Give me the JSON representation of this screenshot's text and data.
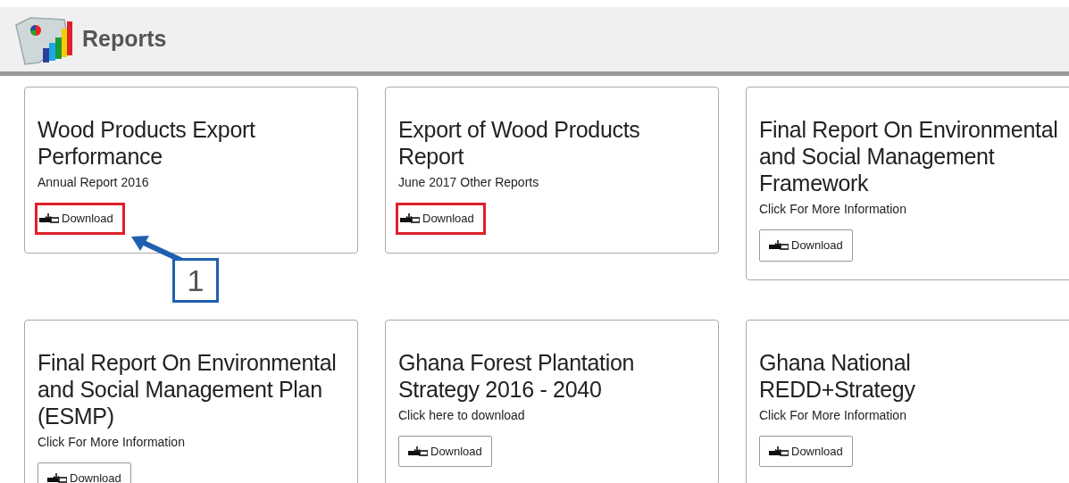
{
  "header": {
    "title": "Reports"
  },
  "reports": [
    {
      "title": "Wood Products Export Performance",
      "subtitle": "Annual Report 2016",
      "button": "Download",
      "highlighted": true
    },
    {
      "title": "Export of Wood Products Report",
      "subtitle": "June 2017 Other Reports",
      "button": "Download",
      "highlighted": true
    },
    {
      "title": "Final Report On Environmental and Social Management Framework",
      "subtitle": "Click For More Information",
      "button": "Download",
      "highlighted": false
    },
    {
      "title": "Final Report On Environmental and Social Management Plan (ESMP)",
      "subtitle": "Click For More Information",
      "button": "Download",
      "highlighted": false
    },
    {
      "title": "Ghana Forest Plantation Strategy 2016 - 2040",
      "subtitle": "Click here to download",
      "button": "Download",
      "highlighted": false
    },
    {
      "title": "Ghana National REDD+Strategy",
      "subtitle": "Click For More Information",
      "button": "Download",
      "highlighted": false
    }
  ],
  "callout": {
    "label": "1"
  }
}
